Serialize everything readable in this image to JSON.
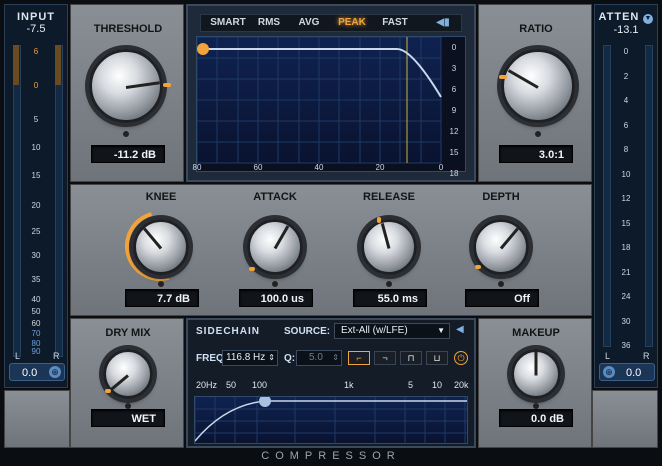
{
  "title": "COMPRESSOR",
  "colors": {
    "accent": "#f2a43a",
    "display_bg": "#0b1020",
    "grid": "#1e3a66",
    "curve": "#c9d8ea",
    "threshold_line": "#c8b43a"
  },
  "input_meter": {
    "title": "INPUT",
    "peak": "-7.5",
    "value": "0.0",
    "left": "L",
    "right": "R",
    "ticks": [
      "6",
      "0",
      "5",
      "10",
      "15",
      "20",
      "25",
      "30",
      "35",
      "40",
      "50",
      "60",
      "70",
      "80",
      "90"
    ]
  },
  "atten_meter": {
    "title": "ATTEN",
    "peak": "-13.1",
    "value": "0.0",
    "left": "L",
    "right": "R",
    "ticks": [
      "0",
      "2",
      "4",
      "6",
      "8",
      "10",
      "12",
      "15",
      "18",
      "21",
      "24",
      "30",
      "36"
    ]
  },
  "threshold": {
    "label": "THRESHOLD",
    "value": "-11.2 dB"
  },
  "ratio": {
    "label": "RATIO",
    "value": "3.0:1"
  },
  "modes": [
    "SMART",
    "RMS",
    "AVG",
    "PEAK",
    "FAST"
  ],
  "active_mode": "PEAK",
  "graph": {
    "x_ticks": [
      "80",
      "60",
      "40",
      "20",
      "0"
    ],
    "y_ticks": [
      "0",
      "3",
      "6",
      "9",
      "12",
      "15",
      "18"
    ]
  },
  "knee": {
    "label": "KNEE",
    "value": "7.7 dB"
  },
  "attack": {
    "label": "ATTACK",
    "value": "100.0 us"
  },
  "release": {
    "label": "RELEASE",
    "value": "55.0 ms"
  },
  "depth": {
    "label": "DEPTH",
    "value": "Off"
  },
  "drymix": {
    "label": "DRY MIX",
    "value": "WET"
  },
  "makeup": {
    "label": "MAKEUP",
    "value": "0.0 dB"
  },
  "sidechain": {
    "title": "SIDECHAIN",
    "source_label": "SOURCE:",
    "source_value": "Ext-All (w/LFE)",
    "freq_label": "FREQ:",
    "freq_value": "116.8 Hz",
    "q_label": "Q:",
    "q_value": "5.0",
    "freq_ticks": [
      "20Hz",
      "50",
      "100",
      "1k",
      "5",
      "10",
      "20k"
    ]
  }
}
